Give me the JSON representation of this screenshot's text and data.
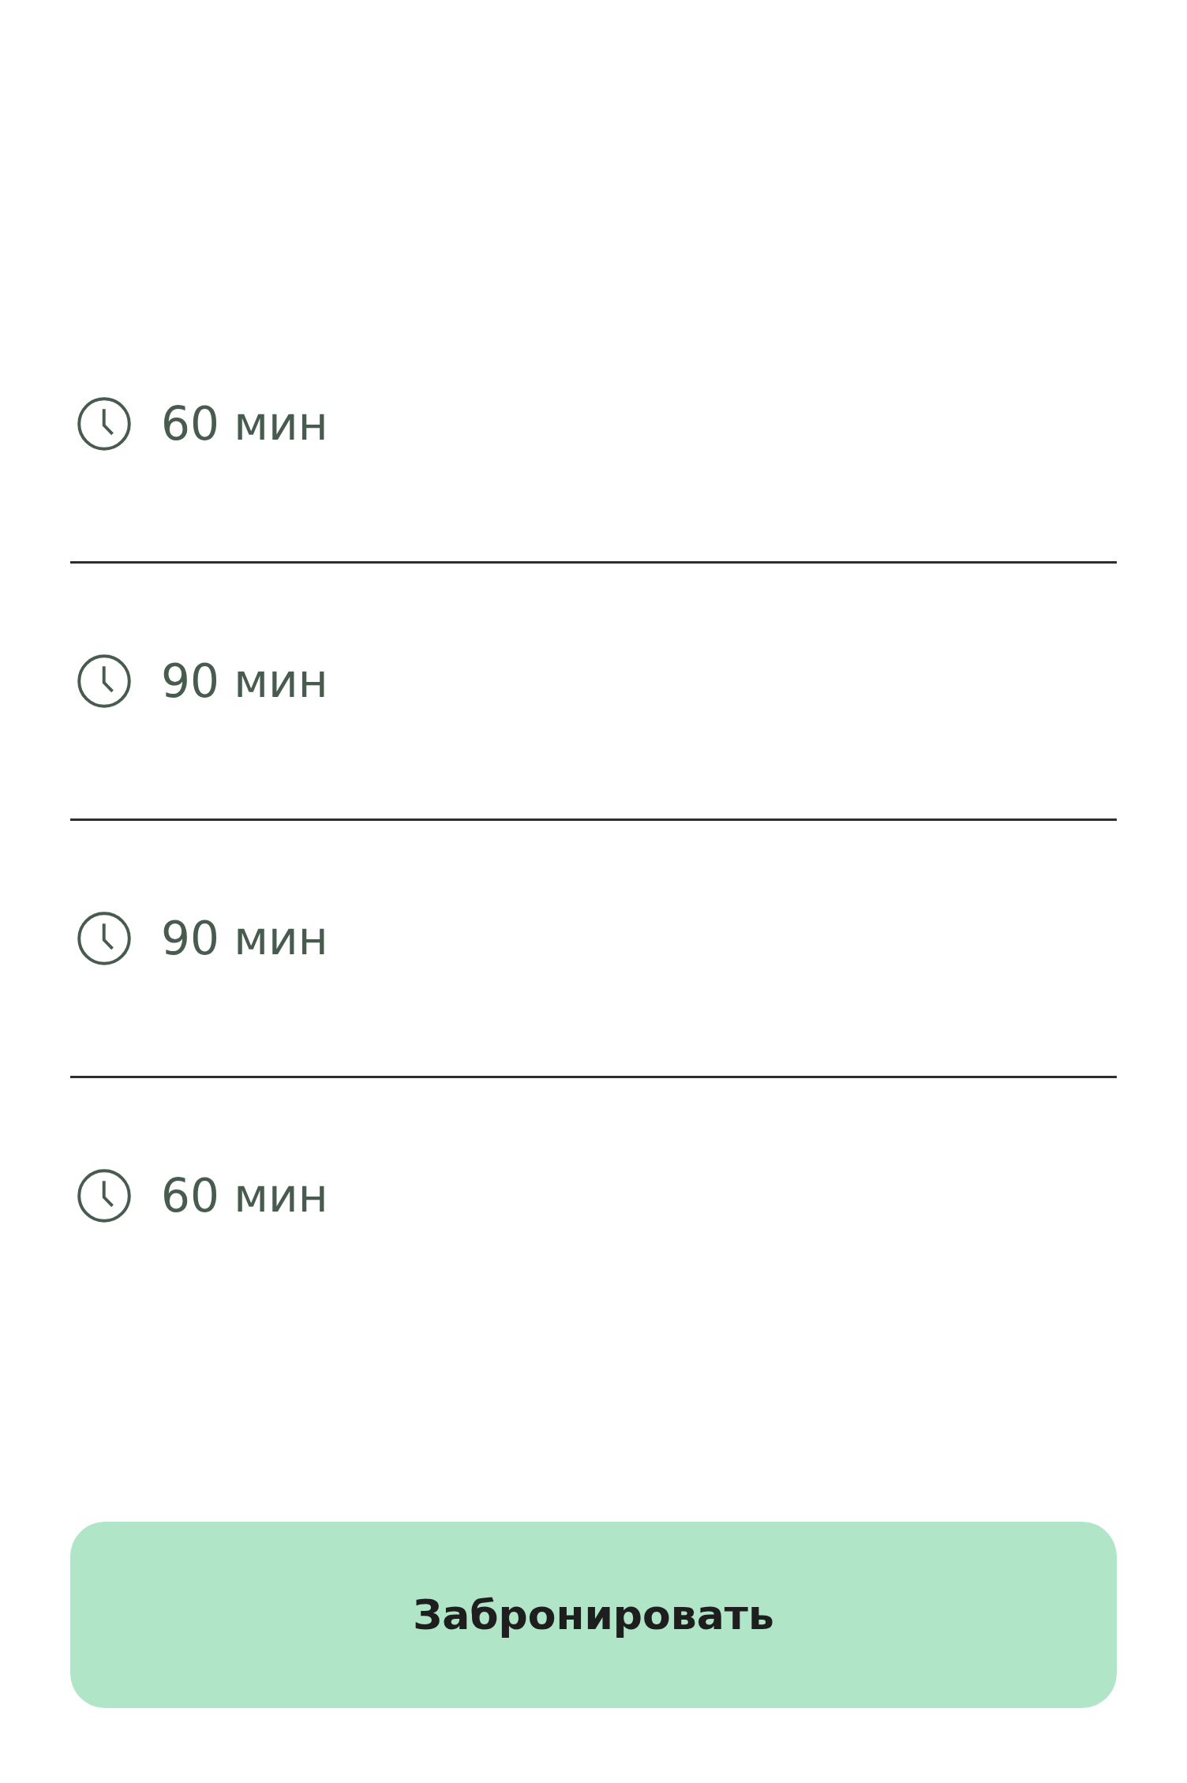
{
  "durations": [
    {
      "label": "60 мин"
    },
    {
      "label": "90 мин"
    },
    {
      "label": "90 мин"
    },
    {
      "label": "60 мин"
    }
  ],
  "book_button": {
    "label": "Забронировать"
  }
}
